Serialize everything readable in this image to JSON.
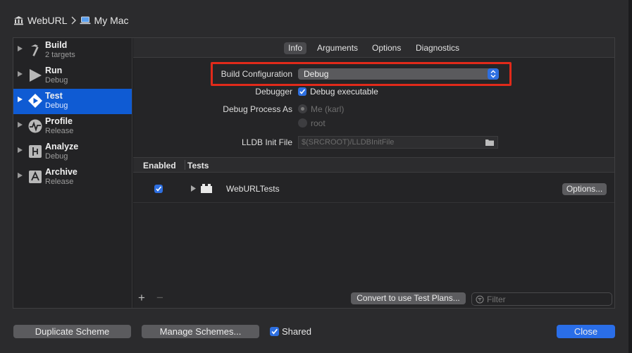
{
  "breadcrumb": {
    "project": "WebURL",
    "destination": "My Mac"
  },
  "sidebar": {
    "items": [
      {
        "name": "Build",
        "sub": "2 targets",
        "icon": "hammer-icon"
      },
      {
        "name": "Run",
        "sub": "Debug",
        "icon": "play-icon"
      },
      {
        "name": "Test",
        "sub": "Debug",
        "icon": "test-diamond-icon"
      },
      {
        "name": "Profile",
        "sub": "Release",
        "icon": "profile-gauge-icon"
      },
      {
        "name": "Analyze",
        "sub": "Debug",
        "icon": "analyze-icon"
      },
      {
        "name": "Archive",
        "sub": "Release",
        "icon": "archive-icon"
      }
    ],
    "selected": "Test"
  },
  "tabs": [
    "Info",
    "Arguments",
    "Options",
    "Diagnostics"
  ],
  "active_tab": "Info",
  "info": {
    "build_config_label": "Build Configuration",
    "build_config_value": "Debug",
    "debugger_label": "Debugger",
    "debugger_checkbox": "Debug executable",
    "debug_process_label": "Debug Process As",
    "process_option_me": "Me (karl)",
    "process_option_root": "root",
    "lldb_label": "LLDB Init File",
    "lldb_placeholder": "$(SRCROOT)/LLDBInitFile"
  },
  "tests_table": {
    "columns": [
      "Enabled",
      "Tests"
    ],
    "rows": [
      {
        "enabled": true,
        "name": "WebURLTests",
        "action": "Options..."
      }
    ]
  },
  "bottom": {
    "add": "+",
    "remove": "−",
    "convert_button": "Convert to use Test Plans...",
    "filter_placeholder": "Filter"
  },
  "footer": {
    "duplicate": "Duplicate Scheme",
    "manage": "Manage Schemes...",
    "shared": "Shared",
    "close": "Close"
  },
  "colors": {
    "accent": "#2a6ee8",
    "selection": "#0f5bd3",
    "highlight_box": "#e12a1a"
  }
}
